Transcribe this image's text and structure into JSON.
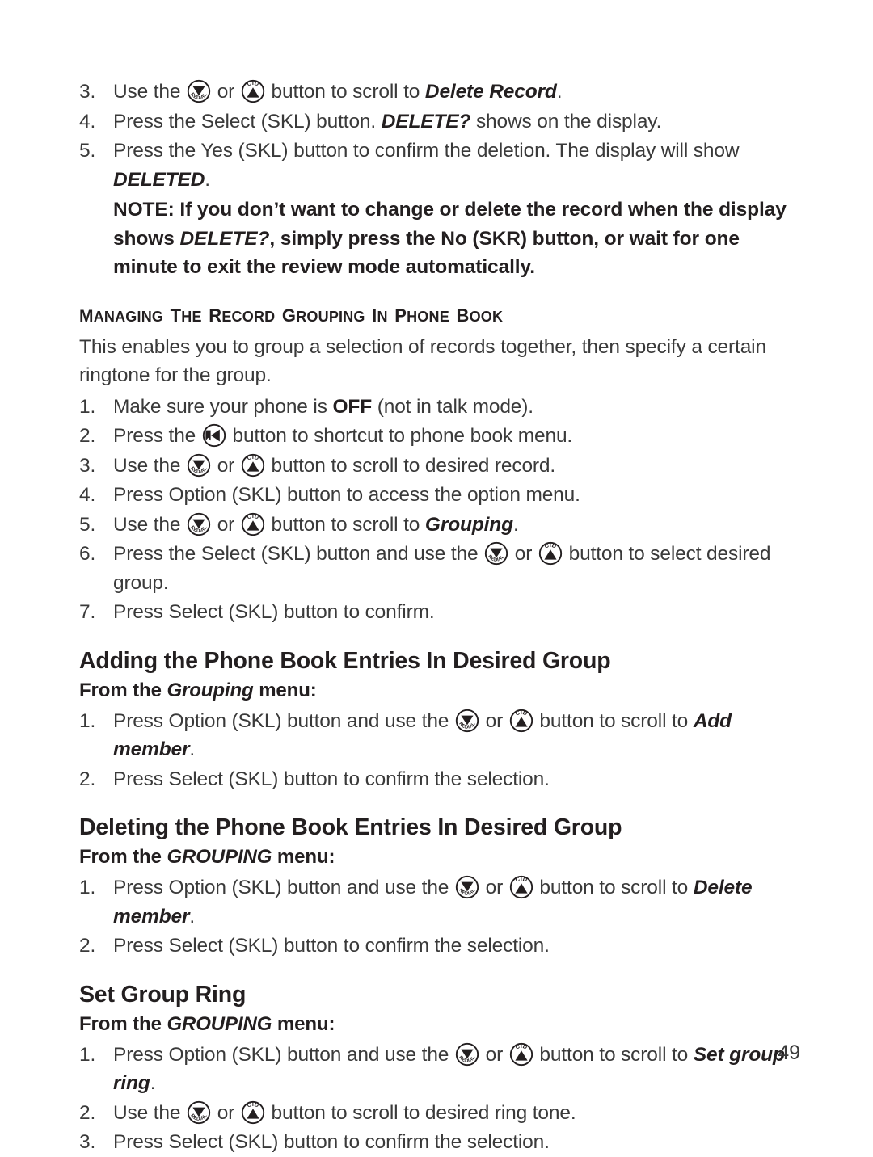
{
  "page": {
    "number": "49",
    "text_color": "#3a3a3a",
    "heading_color": "#231f20",
    "background": "#ffffff"
  },
  "icons": {
    "redial": {
      "name": "redial-down-key-icon",
      "label": "REDIAL",
      "arrow": "down"
    },
    "cid": {
      "name": "cid-up-key-icon",
      "label": "CID",
      "arrow": "up"
    },
    "phonebook": {
      "name": "phone-book-left-key-icon",
      "label": "",
      "arrow": "left"
    }
  },
  "top_steps": [
    {
      "num": "3.",
      "parts": [
        {
          "t": "text",
          "v": "Use the "
        },
        {
          "t": "icon",
          "v": "redial"
        },
        {
          "t": "text",
          "v": " or "
        },
        {
          "t": "icon",
          "v": "cid"
        },
        {
          "t": "text",
          "v": " button to scroll to "
        },
        {
          "t": "bi",
          "v": "Delete Record"
        },
        {
          "t": "text",
          "v": "."
        }
      ]
    },
    {
      "num": "4.",
      "parts": [
        {
          "t": "text",
          "v": "Press the Select (SKL) button. "
        },
        {
          "t": "bi",
          "v": "DELETE?"
        },
        {
          "t": "text",
          "v": " shows on the display."
        }
      ]
    },
    {
      "num": "5.",
      "parts": [
        {
          "t": "text",
          "v": "Press the Yes (SKL) button to confirm the deletion. The display will show "
        },
        {
          "t": "bi",
          "v": "DELETED"
        },
        {
          "t": "text",
          "v": "."
        }
      ]
    }
  ],
  "note": {
    "prefix": "NOTE: If you don’t want to change or delete the record when the display shows ",
    "emphasis": "DELETE?",
    "suffix": ", simply press the No (SKR) button, or wait for one minute to exit the review mode automatically."
  },
  "section": {
    "heading": "Managing the Record Grouping in Phone Book",
    "heading_words": [
      {
        "cap": "M",
        "rest": "ANAGING"
      },
      {
        "cap": "T",
        "rest": "HE"
      },
      {
        "cap": "R",
        "rest": "ECORD"
      },
      {
        "cap": "G",
        "rest": "ROUPING"
      },
      {
        "cap": "I",
        "rest": "N"
      },
      {
        "cap": "P",
        "rest": "HONE"
      },
      {
        "cap": "B",
        "rest": "OOK"
      }
    ],
    "intro": "This enables you to group a selection of records together, then specify a certain ringtone for the group.",
    "steps": [
      {
        "num": "1.",
        "parts": [
          {
            "t": "text",
            "v": "Make sure your phone is "
          },
          {
            "t": "b",
            "v": "OFF"
          },
          {
            "t": "text",
            "v": " (not in talk mode)."
          }
        ]
      },
      {
        "num": "2.",
        "parts": [
          {
            "t": "text",
            "v": "Press the "
          },
          {
            "t": "icon",
            "v": "phonebook"
          },
          {
            "t": "text",
            "v": " button to shortcut to phone book menu."
          }
        ]
      },
      {
        "num": "3.",
        "parts": [
          {
            "t": "text",
            "v": "Use the "
          },
          {
            "t": "icon",
            "v": "redial"
          },
          {
            "t": "text",
            "v": " or "
          },
          {
            "t": "icon",
            "v": "cid"
          },
          {
            "t": "text",
            "v": " button to scroll to desired record."
          }
        ]
      },
      {
        "num": "4.",
        "parts": [
          {
            "t": "text",
            "v": "Press Option (SKL) button to access the option menu."
          }
        ]
      },
      {
        "num": "5.",
        "parts": [
          {
            "t": "text",
            "v": "Use the "
          },
          {
            "t": "icon",
            "v": "redial"
          },
          {
            "t": "text",
            "v": " or "
          },
          {
            "t": "icon",
            "v": "cid"
          },
          {
            "t": "text",
            "v": " button to scroll to "
          },
          {
            "t": "bi",
            "v": "Grouping"
          },
          {
            "t": "text",
            "v": "."
          }
        ]
      },
      {
        "num": "6.",
        "parts": [
          {
            "t": "text",
            "v": "Press the Select (SKL) button and use the "
          },
          {
            "t": "icon",
            "v": "redial"
          },
          {
            "t": "text",
            "v": " or "
          },
          {
            "t": "icon",
            "v": "cid"
          },
          {
            "t": "text",
            "v": " button to select desired group."
          }
        ]
      },
      {
        "num": "7.",
        "parts": [
          {
            "t": "text",
            "v": "Press Select (SKL) button to confirm."
          }
        ]
      }
    ]
  },
  "subsections": [
    {
      "title": "Adding the Phone Book Entries In Desired Group",
      "from_prefix": "From the ",
      "from_menu": "Grouping",
      "from_suffix": " menu:",
      "steps": [
        {
          "num": "1.",
          "parts": [
            {
              "t": "text",
              "v": "Press Option (SKL) button and use the "
            },
            {
              "t": "icon",
              "v": "redial"
            },
            {
              "t": "text",
              "v": " or "
            },
            {
              "t": "icon",
              "v": "cid"
            },
            {
              "t": "text",
              "v": " button to scroll to "
            },
            {
              "t": "bi",
              "v": "Add member"
            },
            {
              "t": "text",
              "v": "."
            }
          ]
        },
        {
          "num": "2.",
          "parts": [
            {
              "t": "text",
              "v": "Press Select (SKL) button to confirm the selection."
            }
          ]
        }
      ]
    },
    {
      "title": "Deleting the Phone Book Entries In Desired Group",
      "from_prefix": "From the ",
      "from_menu": "GROUPING",
      "from_suffix": " menu:",
      "steps": [
        {
          "num": "1.",
          "parts": [
            {
              "t": "text",
              "v": "Press Option (SKL) button and use the "
            },
            {
              "t": "icon",
              "v": "redial"
            },
            {
              "t": "text",
              "v": " or "
            },
            {
              "t": "icon",
              "v": "cid"
            },
            {
              "t": "text",
              "v": " button to scroll to "
            },
            {
              "t": "bi",
              "v": "Delete member"
            },
            {
              "t": "text",
              "v": "."
            }
          ]
        },
        {
          "num": "2.",
          "parts": [
            {
              "t": "text",
              "v": "Press Select (SKL) button to confirm the selection."
            }
          ]
        }
      ]
    },
    {
      "title": "Set Group Ring",
      "from_prefix": "From the ",
      "from_menu": "GROUPING",
      "from_suffix": " menu:",
      "steps": [
        {
          "num": "1.",
          "parts": [
            {
              "t": "text",
              "v": "Press Option (SKL) button and use the "
            },
            {
              "t": "icon",
              "v": "redial"
            },
            {
              "t": "text",
              "v": " or "
            },
            {
              "t": "icon",
              "v": "cid"
            },
            {
              "t": "text",
              "v": " button to scroll to "
            },
            {
              "t": "bi",
              "v": "Set group ring"
            },
            {
              "t": "text",
              "v": "."
            }
          ]
        },
        {
          "num": "2.",
          "parts": [
            {
              "t": "text",
              "v": "Use the "
            },
            {
              "t": "icon",
              "v": "redial"
            },
            {
              "t": "text",
              "v": " or "
            },
            {
              "t": "icon",
              "v": "cid"
            },
            {
              "t": "text",
              "v": " button to scroll to desired ring tone."
            }
          ]
        },
        {
          "num": "3.",
          "parts": [
            {
              "t": "text",
              "v": "Press Select (SKL) button to confirm the selection."
            }
          ]
        }
      ]
    }
  ]
}
